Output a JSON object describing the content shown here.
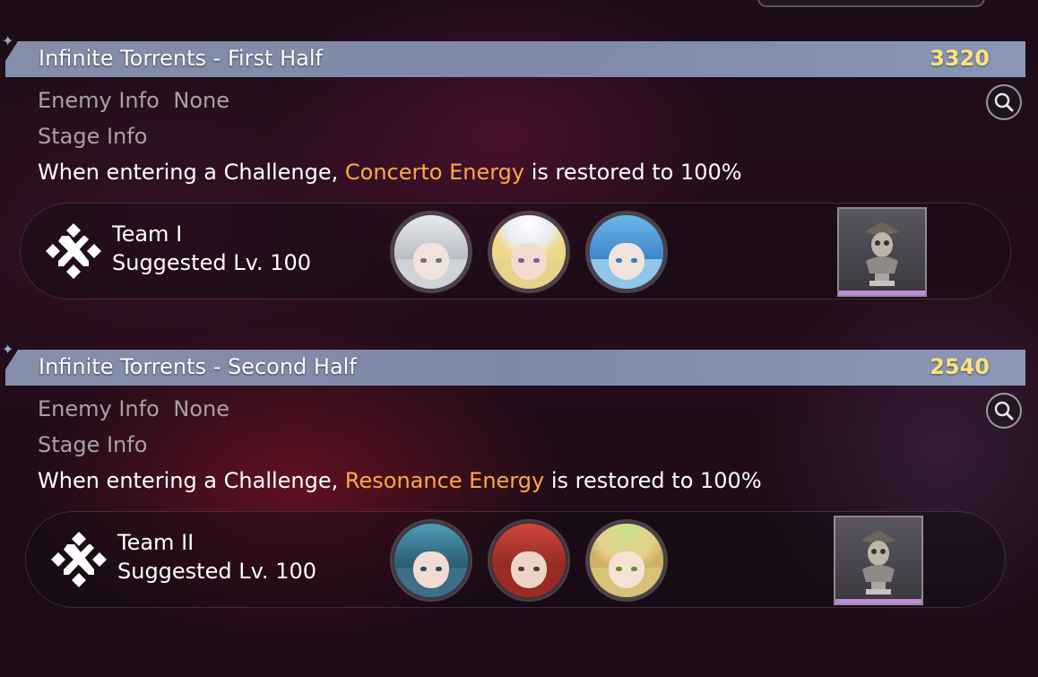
{
  "stages": [
    {
      "title": "Infinite Torrents - First Half",
      "score": "3320",
      "enemy_label": "Enemy Info",
      "enemy_value": "None",
      "stage_label": "Stage Info",
      "stage_text_pre": "When entering a Challenge, ",
      "stage_text_highlight": "Concerto Energy",
      "stage_text_post": " is restored to 100%",
      "team_name": "Team I",
      "suggested_level": "Suggested Lv. 100",
      "avatars": [
        "white-haired-character",
        "blonde-hat-character",
        "blue-haired-character"
      ],
      "reward_icon": "pirate-bust-trophy-icon"
    },
    {
      "title": "Infinite Torrents - Second Half",
      "score": "2540",
      "enemy_label": "Enemy Info",
      "enemy_value": "None",
      "stage_label": "Stage Info",
      "stage_text_pre": "When entering a Challenge, ",
      "stage_text_highlight": "Resonance Energy",
      "stage_text_post": " is restored to 100%",
      "team_name": "Team II",
      "suggested_level": "Suggested Lv. 100",
      "avatars": [
        "teal-haired-character",
        "red-haired-character",
        "green-bow-character"
      ],
      "reward_icon": "pirate-bust-trophy-icon"
    }
  ],
  "colors": {
    "accent": "#ffaa3c",
    "score": "#ffe27a",
    "header_bar": "#8c9abb",
    "reward_rarity": "#c08ad8"
  }
}
